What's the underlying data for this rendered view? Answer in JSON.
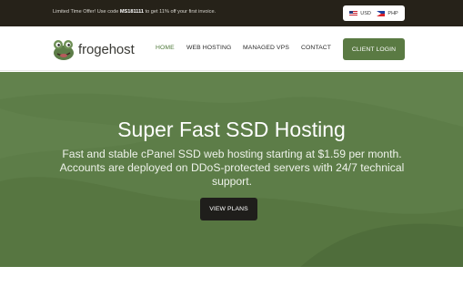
{
  "topbar": {
    "promo_prefix": "Limited Time Offer! Use code ",
    "promo_code": "MS181111",
    "promo_suffix": " to get 11% off your first invoice.",
    "currencies": [
      {
        "label": "USD",
        "flag": "us-flag-icon"
      },
      {
        "label": "PHP",
        "flag": "ph-flag-icon"
      }
    ]
  },
  "navbar": {
    "logo_text": "frogehost",
    "logo_icon": "frog-icon",
    "items": [
      {
        "label": "HOME",
        "active": true
      },
      {
        "label": "WEB HOSTING",
        "active": false
      },
      {
        "label": "MANAGED VPS",
        "active": false
      },
      {
        "label": "CONTACT",
        "active": false
      }
    ],
    "login_label": "CLIENT LOGIN"
  },
  "hero": {
    "title": "Super Fast SSD Hosting",
    "subtitle": "Fast and stable cPanel SSD web hosting starting at $1.59 per month. Accounts are deployed on DDoS-protected servers with 24/7 technical support.",
    "button_label": "VIEW PLANS"
  },
  "colors": {
    "topbar_bg": "#262219",
    "accent_green": "#5a7a43",
    "hero_bg": "#5d7d48",
    "active_nav": "#4f7a3b",
    "dark_button": "#1f1e1b"
  }
}
